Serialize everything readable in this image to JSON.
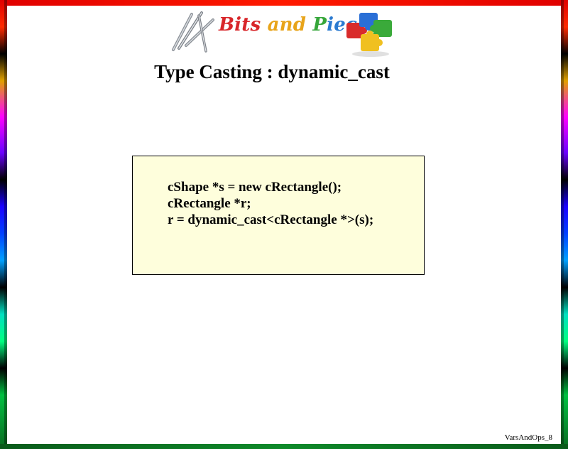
{
  "logo": {
    "word1": "Bits",
    "word2": "and",
    "word3": "Pieces",
    "drills_icon": "drill-bits-icon",
    "puzzle_icon": "puzzle-pieces-icon",
    "colors": {
      "red": "#d8262a",
      "orange": "#e8a41a",
      "green": "#36a63a",
      "blue": "#2a7ad0"
    }
  },
  "title": "Type Casting : dynamic_cast",
  "code": {
    "lines": [
      "cShape *s = new cRectangle();",
      "cRectangle *r;",
      "r = dynamic_cast<cRectangle *>(s);"
    ],
    "background": "#fefedc"
  },
  "footer": "VarsAndOps_8"
}
